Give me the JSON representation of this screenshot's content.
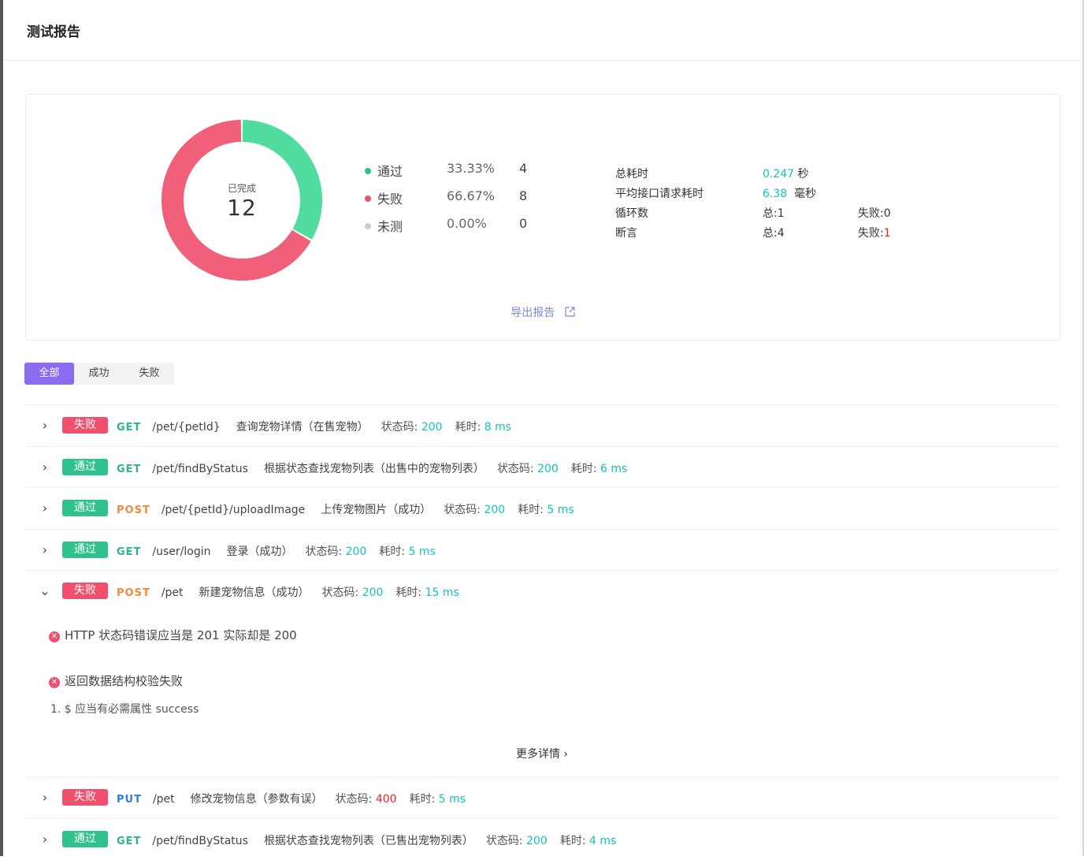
{
  "header": {
    "title": "测试报告"
  },
  "summary": {
    "donut_label": "已完成",
    "total": "12",
    "chart_segments": [
      {
        "name": "通过",
        "fraction": 0.3333,
        "color": "#4fdc9e"
      },
      {
        "name": "失败",
        "fraction": 0.6667,
        "color": "#f0607a"
      }
    ],
    "legend": [
      {
        "name": "通过",
        "pct": "33.33%",
        "count": "4",
        "color": "#2fc28c"
      },
      {
        "name": "失败",
        "pct": "66.67%",
        "count": "8",
        "color": "#f0506e"
      },
      {
        "name": "未测",
        "pct": "0.00%",
        "count": "0",
        "color": "#cccccc"
      }
    ],
    "stats": {
      "total_time_label": "总耗时",
      "total_time_value": "0.247",
      "total_time_unit": "秒",
      "avg_label": "平均接口请求耗时",
      "avg_value": "6.38",
      "avg_unit": "毫秒",
      "loops_label": "循环数",
      "loops_total": "总:1",
      "loops_fail": "失败:0",
      "assert_label": "断言",
      "assert_total": "总:4",
      "assert_fail_label": "失败:",
      "assert_fail_value": "1"
    },
    "export_label": "导出报告",
    "export_icon": "external-link-icon"
  },
  "tabs": [
    {
      "label": "全部",
      "active": true
    },
    {
      "label": "成功",
      "active": false
    },
    {
      "label": "失败",
      "active": false
    }
  ],
  "rows": [
    {
      "chev": "›",
      "status": "失败",
      "type": "fail",
      "method": "GET",
      "mclass": "m-get",
      "path": "/pet/{petId}",
      "desc": "查询宠物详情（在售宠物）",
      "code_label": "状态码:",
      "code": "200",
      "code_color": "teal",
      "time_label": "耗时:",
      "time": "8 ms"
    },
    {
      "chev": "›",
      "status": "通过",
      "type": "pass",
      "method": "GET",
      "mclass": "m-get",
      "path": "/pet/findByStatus",
      "desc": "根据状态查找宠物列表（出售中的宠物列表）",
      "code_label": "状态码:",
      "code": "200",
      "code_color": "teal",
      "time_label": "耗时:",
      "time": "6 ms"
    },
    {
      "chev": "›",
      "status": "通过",
      "type": "pass",
      "method": "POST",
      "mclass": "m-post",
      "path": "/pet/{petId}/uploadImage",
      "desc": "上传宠物图片（成功）",
      "code_label": "状态码:",
      "code": "200",
      "code_color": "teal",
      "time_label": "耗时:",
      "time": "5 ms"
    },
    {
      "chev": "›",
      "status": "通过",
      "type": "pass",
      "method": "GET",
      "mclass": "m-get",
      "path": "/user/login",
      "desc": "登录（成功）",
      "code_label": "状态码:",
      "code": "200",
      "code_color": "teal",
      "time_label": "耗时:",
      "time": "5 ms"
    },
    {
      "chev": "⌄",
      "status": "失败",
      "type": "fail",
      "method": "POST",
      "mclass": "m-post",
      "path": "/pet",
      "desc": "新建宠物信息（成功）",
      "code_label": "状态码:",
      "code": "200",
      "code_color": "teal",
      "time_label": "耗时:",
      "time": "15 ms"
    },
    {
      "chev": "›",
      "status": "失败",
      "type": "fail",
      "method": "PUT",
      "mclass": "m-put",
      "path": "/pet",
      "desc": "修改宠物信息（参数有误）",
      "code_label": "状态码:",
      "code": "400",
      "code_color": "red",
      "time_label": "耗时:",
      "time": "5 ms"
    },
    {
      "chev": "›",
      "status": "通过",
      "type": "pass",
      "method": "GET",
      "mclass": "m-get",
      "path": "/pet/findByStatus",
      "desc": "根据状态查找宠物列表（已售出宠物列表）",
      "code_label": "状态码:",
      "code": "200",
      "code_color": "teal",
      "time_label": "耗时:",
      "time": "4 ms"
    }
  ],
  "detail": {
    "error1": "HTTP 状态码错误应当是 201 实际却是 200",
    "error2": "返回数据结构校验失败",
    "sub1": "1. $ 应当有必需属性 success",
    "more": "更多详情 ›"
  }
}
